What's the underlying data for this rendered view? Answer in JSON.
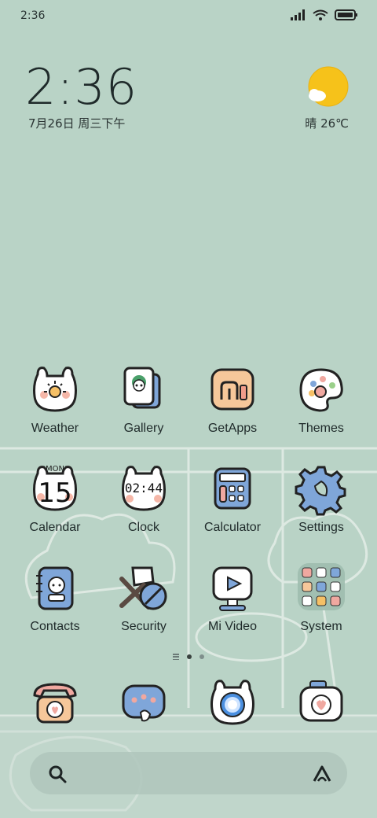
{
  "status": {
    "time": "2:36"
  },
  "widget": {
    "time": "2:36",
    "date": "7月26日 周三下午",
    "weather": "晴 26℃"
  },
  "apps": [
    {
      "label": "Weather",
      "icon": "weather-icon"
    },
    {
      "label": "Gallery",
      "icon": "gallery-icon"
    },
    {
      "label": "GetApps",
      "icon": "getapps-icon"
    },
    {
      "label": "Themes",
      "icon": "themes-icon"
    },
    {
      "label": "Calendar",
      "icon": "calendar-icon",
      "day": "MON",
      "date": "15"
    },
    {
      "label": "Clock",
      "icon": "clock-icon",
      "time": "02:44"
    },
    {
      "label": "Calculator",
      "icon": "calculator-icon"
    },
    {
      "label": "Settings",
      "icon": "settings-icon"
    },
    {
      "label": "Contacts",
      "icon": "contacts-icon"
    },
    {
      "label": "Security",
      "icon": "security-icon"
    },
    {
      "label": "Mi Video",
      "icon": "mivideo-icon"
    },
    {
      "label": "System",
      "icon": "system-folder-icon"
    }
  ],
  "dock": [
    {
      "icon": "phone-icon"
    },
    {
      "icon": "messages-icon"
    },
    {
      "icon": "browser-icon"
    },
    {
      "icon": "camera-icon"
    }
  ],
  "search": {
    "left_icon": "search-icon",
    "right_icon": "assistant-icon"
  },
  "colors": {
    "background": "#b9d3c6",
    "sun": "#f6c21a",
    "accent_blue": "#7fa6d9",
    "accent_pink": "#f0a8a0"
  }
}
